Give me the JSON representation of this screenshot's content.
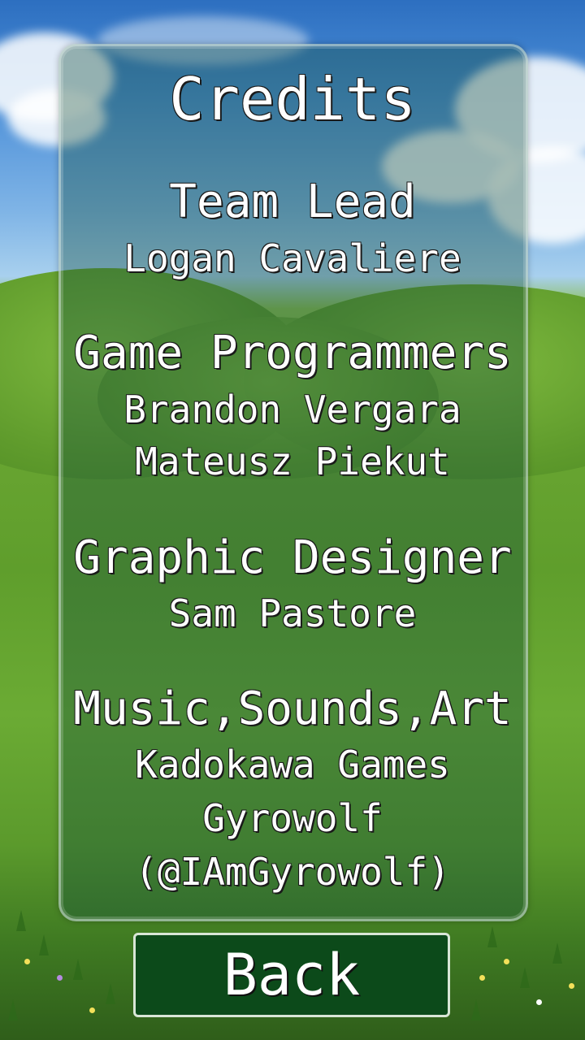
{
  "screen": {
    "title": "Credits"
  },
  "sections": [
    {
      "heading": "Team Lead",
      "names": [
        "Logan Cavaliere"
      ]
    },
    {
      "heading": "Game Programmers",
      "names": [
        "Brandon Vergara",
        "Mateusz Piekut"
      ]
    },
    {
      "heading": "Graphic Designer",
      "names": [
        "Sam Pastore"
      ]
    },
    {
      "heading": "Music,Sounds,Art",
      "names": [
        "Kadokawa Games",
        "Gyrowolf",
        "(@IAmGyrowolf)"
      ]
    }
  ],
  "buttons": {
    "back_label": "Back"
  },
  "colors": {
    "panel_tint": "#14503c",
    "button_bg": "#0c4a1a",
    "text": "#ffffff"
  }
}
